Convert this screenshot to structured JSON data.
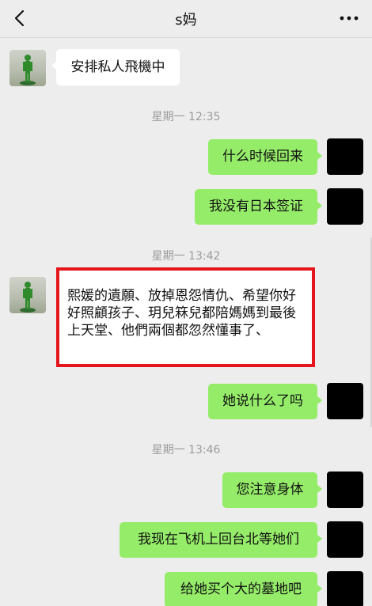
{
  "header": {
    "title": "s妈"
  },
  "messages": [
    {
      "side": "left",
      "text": "安排私人飛機中"
    },
    {
      "type": "time",
      "text": "星期一 12:35"
    },
    {
      "side": "right",
      "text": "什么时候回来"
    },
    {
      "side": "right",
      "text": "我没有日本签证"
    },
    {
      "type": "time",
      "text": "星期一 13:42"
    },
    {
      "side": "left",
      "text": "熙媛的遺願、放掉恩怨情仇、希望你好好照顧孩子、玥兒箖兒都陪媽媽到最後上天堂、他們兩個都忽然懂事了、",
      "highlighted": true
    },
    {
      "side": "right",
      "text": "她说什么了吗"
    },
    {
      "type": "time",
      "text": "星期一 13:46"
    },
    {
      "side": "right",
      "text": "您注意身体"
    },
    {
      "side": "right",
      "text": "我现在飞机上回台北等她们"
    },
    {
      "side": "right",
      "text": "给她买个大的墓地吧"
    }
  ],
  "colors": {
    "background": "#ededed",
    "outgoing_bubble": "#95ec69",
    "incoming_bubble": "#ffffff",
    "highlight_border": "#e4151c"
  },
  "icons": {
    "back": "chevron-left-icon",
    "more": "more-dots-icon"
  }
}
